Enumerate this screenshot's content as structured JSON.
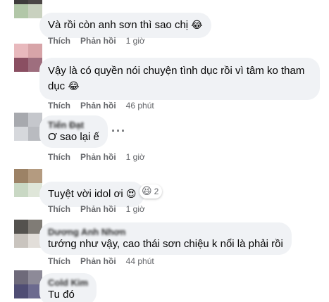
{
  "labels": {
    "like": "Thích",
    "reply": "Phản hồi"
  },
  "comments": [
    {
      "name": "",
      "text": "Và rồi còn anh sơn thì sao chị",
      "emoji": "😂",
      "time": "1 giờ"
    },
    {
      "name": "",
      "text": "Vậy là có quyền nói chuyện tình dục rồi vì tâm ko tham",
      "text2": "dục",
      "emoji": "😂",
      "time": "46 phút"
    },
    {
      "name": "Tiến Đạt",
      "text": "Ơ sao lại ế",
      "time": "1 giờ"
    },
    {
      "name": "",
      "text": "Tuyệt vời idol ơi",
      "emoji": "😍",
      "reaction_emoji": "😆",
      "reaction_count": "2",
      "time": "1 giờ"
    },
    {
      "name": "Dương Anh Nhơn",
      "text": "tướng như vậy, cao thái sơn chiệu k nổi là phải rồi",
      "time": "44 phút"
    },
    {
      "name": "Cold Kim",
      "text": "Tu đó"
    }
  ],
  "more_glyph": "···",
  "colors": {
    "bubble": "#f0f2f5",
    "meta": "#65676b",
    "text": "#050505"
  }
}
